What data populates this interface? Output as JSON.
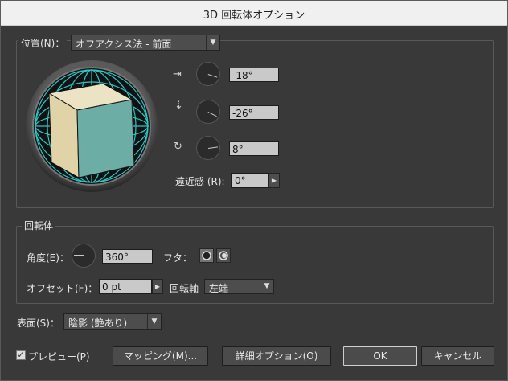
{
  "window": {
    "title": "3D 回転体オプション"
  },
  "position_group": {
    "label": "位置(N)：",
    "preset": "オフアクシス法 - 前面",
    "x_angle": "-18°",
    "y_angle": "-26°",
    "z_angle": "8°",
    "perspective_label": "遠近感 (R):",
    "perspective_value": "0°"
  },
  "revolve_group": {
    "title": "回転体",
    "angle_label": "角度(E)：",
    "angle_value": "360°",
    "cap_label": "フタ：",
    "offset_label": "オフセット(F)：",
    "offset_value": "0 pt",
    "axis_label": "回転軸",
    "axis_value": "左端"
  },
  "surface": {
    "label": "表面(S)：",
    "value": "陰影 (艶あり)"
  },
  "footer": {
    "preview_label": "プレビュー(P)",
    "mapping_label": "マッピング(M)...",
    "more_options_label": "詳細オプション(O)",
    "ok_label": "OK",
    "cancel_label": "キャンセル"
  },
  "colors": {
    "cube_front": "#6cada5",
    "cube_left": "#e0d3a8",
    "cube_top": "#ece3c4",
    "grid": "#27c8c8"
  }
}
